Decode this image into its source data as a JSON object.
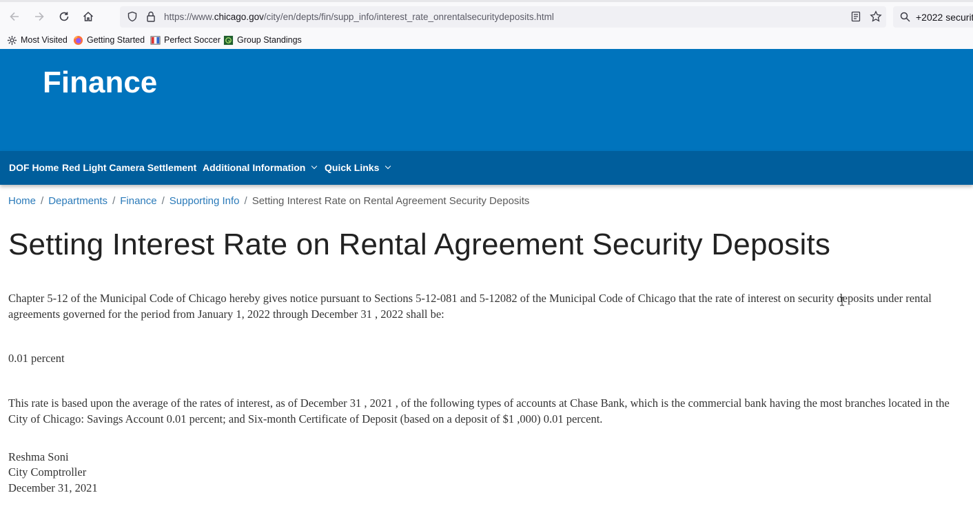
{
  "browser": {
    "url_prefix": "https://www.",
    "url_domain": "chicago.gov",
    "url_path": "/city/en/depts/fin/supp_info/interest_rate_onrentalsecuritydeposits.html",
    "search_text": "+2022 security"
  },
  "bookmarks": [
    {
      "label": "Most Visited",
      "icon": "gear-icon"
    },
    {
      "label": "Getting Started",
      "icon": "firefox-icon"
    },
    {
      "label": "Perfect Soccer",
      "icon": "soccer-icon"
    },
    {
      "label": "Group Standings",
      "icon": "standings-icon"
    }
  ],
  "site": {
    "title": "Finance",
    "nav": [
      "DOF Home",
      "Red Light Camera Settlement",
      "Additional Information",
      "Quick Links"
    ]
  },
  "breadcrumb": [
    "Home",
    "Departments",
    "Finance",
    "Supporting Info",
    "Setting Interest Rate on Rental Agreement Security Deposits"
  ],
  "page": {
    "title": "Setting Interest Rate on Rental Agreement Security Deposits",
    "para1": "Chapter 5-12 of the Municipal Code of Chicago hereby gives notice pursuant to Sections 5-12-081 and 5-12082 of the Municipal Code of Chicago that the rate of interest on security deposits under rental agreements governed for the period from January 1, 2022 through December 31 , 2022 shall be:",
    "rate": "0.01 percent",
    "para2": "This rate is based upon the average of the rates of interest, as of December 31 , 2021 , of the following types of accounts at Chase Bank, which is the commercial bank having the most branches located in the City of Chicago: Savings Account 0.01 percent; and Six-month Certificate of Deposit (based on a deposit of $1 ,000) 0.01 percent.",
    "signer_name": "Reshma Soni",
    "signer_title": "City Comptroller",
    "signed_date": "December 31, 2021"
  },
  "colors": {
    "header_blue": "#0074bd",
    "nav_blue": "#005e9c",
    "link_blue": "#2a7ab9"
  }
}
